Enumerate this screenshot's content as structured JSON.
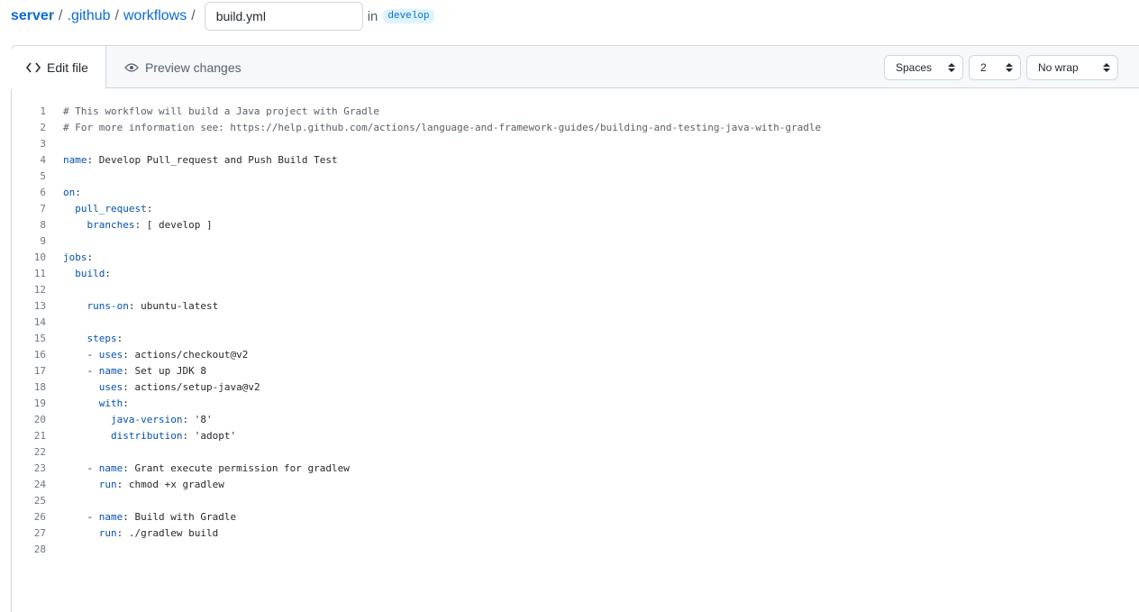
{
  "breadcrumb": {
    "repo": "server",
    "separator": "/",
    "folder1": ".github",
    "folder2": "workflows",
    "filename_value": "build.yml",
    "in_label": "in",
    "branch": "develop"
  },
  "tabs": {
    "edit_label": "Edit file",
    "preview_label": "Preview changes"
  },
  "editor_settings": {
    "indent_mode": "Spaces",
    "indent_size": "2",
    "wrap_mode": "No wrap"
  },
  "code_lines": [
    {
      "n": "1",
      "indent": "",
      "key": "",
      "rest": "# This workflow will build a Java project with Gradle",
      "comment": true
    },
    {
      "n": "2",
      "indent": "",
      "key": "",
      "rest": "# For more information see: https://help.github.com/actions/language-and-framework-guides/building-and-testing-java-with-gradle",
      "comment": true
    },
    {
      "n": "3",
      "indent": "",
      "key": "",
      "rest": ""
    },
    {
      "n": "4",
      "indent": "",
      "key": "name",
      "rest": ": Develop Pull_request and Push Build Test"
    },
    {
      "n": "5",
      "indent": "",
      "key": "",
      "rest": ""
    },
    {
      "n": "6",
      "indent": "",
      "key": "on",
      "rest": ":"
    },
    {
      "n": "7",
      "indent": "  ",
      "key": "pull_request",
      "rest": ":"
    },
    {
      "n": "8",
      "indent": "    ",
      "key": "branches",
      "rest": ": [ develop ]"
    },
    {
      "n": "9",
      "indent": "",
      "key": "",
      "rest": ""
    },
    {
      "n": "10",
      "indent": "",
      "key": "jobs",
      "rest": ":"
    },
    {
      "n": "11",
      "indent": "  ",
      "key": "build",
      "rest": ":"
    },
    {
      "n": "12",
      "indent": "",
      "key": "",
      "rest": ""
    },
    {
      "n": "13",
      "indent": "    ",
      "key": "runs-on",
      "rest": ": ubuntu-latest"
    },
    {
      "n": "14",
      "indent": "",
      "key": "",
      "rest": ""
    },
    {
      "n": "15",
      "indent": "    ",
      "key": "steps",
      "rest": ":"
    },
    {
      "n": "16",
      "indent": "    - ",
      "key": "uses",
      "rest": ": actions/checkout@v2"
    },
    {
      "n": "17",
      "indent": "    - ",
      "key": "name",
      "rest": ": Set up JDK 8"
    },
    {
      "n": "18",
      "indent": "      ",
      "key": "uses",
      "rest": ": actions/setup-java@v2"
    },
    {
      "n": "19",
      "indent": "      ",
      "key": "with",
      "rest": ":"
    },
    {
      "n": "20",
      "indent": "        ",
      "key": "java-version",
      "rest": ": '8'"
    },
    {
      "n": "21",
      "indent": "        ",
      "key": "distribution",
      "rest": ": 'adopt'"
    },
    {
      "n": "22",
      "indent": "",
      "key": "",
      "rest": ""
    },
    {
      "n": "23",
      "indent": "    - ",
      "key": "name",
      "rest": ": Grant execute permission for gradlew"
    },
    {
      "n": "24",
      "indent": "      ",
      "key": "run",
      "rest": ": chmod +x gradlew"
    },
    {
      "n": "25",
      "indent": "",
      "key": "",
      "rest": ""
    },
    {
      "n": "26",
      "indent": "    - ",
      "key": "name",
      "rest": ": Build with Gradle"
    },
    {
      "n": "27",
      "indent": "      ",
      "key": "run",
      "rest": ": ./gradlew build"
    },
    {
      "n": "28",
      "indent": "",
      "key": "",
      "rest": ""
    }
  ]
}
